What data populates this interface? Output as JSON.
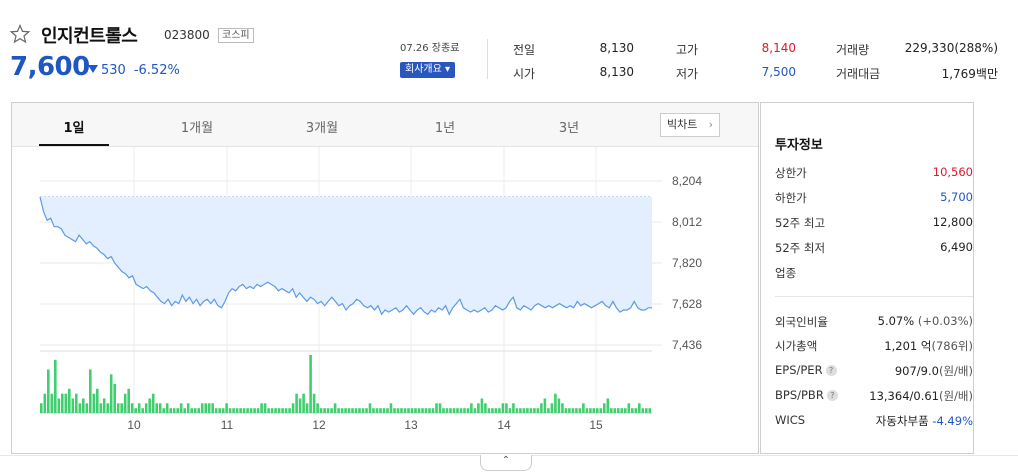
{
  "stock": {
    "name": "인지컨트롤스",
    "code": "023800",
    "market": "코스피",
    "price": "7,600",
    "change": "530",
    "change_pct": "-6.52%",
    "market_time": "07.26 장종료",
    "company_button": "회사개요 ▾"
  },
  "quote": {
    "prev_label": "전일",
    "prev": "8,130",
    "open_label": "시가",
    "open": "8,130",
    "high_label": "고가",
    "high": "8,140",
    "low_label": "저가",
    "low": "7,500",
    "volume_label": "거래량",
    "volume": "229,330(288%)",
    "amount_label": "거래대금",
    "amount": "1,769백만"
  },
  "tabs": [
    "1일",
    "1개월",
    "3개월",
    "1년",
    "3년"
  ],
  "big_chart_label": "빅차트",
  "fold_label": "⌃",
  "invest": {
    "title": "투자정보",
    "upper_label": "상한가",
    "upper": "10,560",
    "lower_label": "하한가",
    "lower": "5,700",
    "high52_label": "52주 최고",
    "high52": "12,800",
    "low52_label": "52주 최저",
    "low52": "6,490",
    "industry_label": "업종",
    "foreign_label": "외국인비율",
    "foreign": "5.07%",
    "foreign_chg": "(+0.03%)",
    "mcap_label": "시가총액",
    "mcap": "1,201 억",
    "mcap_rank": "(786위)",
    "eps_label": "EPS/PER",
    "eps": "907/9.0",
    "eps_unit": "(원/배)",
    "bps_label": "BPS/PBR",
    "bps": "13,364/0.61",
    "bps_unit": "(원/배)",
    "wics_label": "WICS",
    "wics": "자동차부품",
    "wics_chg": "-4.49%"
  },
  "colors": {
    "up": "#e0182d",
    "down": "#1e57c4",
    "area": "#e3efff",
    "line": "#5b9ae8",
    "volume": "#3fcf6e"
  },
  "chart_data": {
    "type": "line",
    "yticks": [
      "8,204",
      "8,012",
      "7,820",
      "7,628",
      "7,436"
    ],
    "ylim": [
      7436,
      8204
    ],
    "prev_close": 8130,
    "xticks": [
      "10",
      "11",
      "12",
      "13",
      "14",
      "15"
    ],
    "price": [
      8130,
      8060,
      8020,
      8030,
      7990,
      7990,
      7980,
      7950,
      7940,
      7930,
      7920,
      7950,
      7930,
      7910,
      7920,
      7900,
      7890,
      7870,
      7860,
      7840,
      7850,
      7820,
      7800,
      7780,
      7770,
      7750,
      7760,
      7720,
      7710,
      7700,
      7710,
      7690,
      7680,
      7660,
      7640,
      7630,
      7650,
      7620,
      7640,
      7630,
      7670,
      7640,
      7660,
      7630,
      7650,
      7620,
      7640,
      7650,
      7630,
      7650,
      7620,
      7610,
      7640,
      7680,
      7700,
      7690,
      7710,
      7720,
      7700,
      7710,
      7700,
      7720,
      7710,
      7720,
      7730,
      7720,
      7710,
      7690,
      7700,
      7690,
      7680,
      7700,
      7660,
      7680,
      7660,
      7640,
      7660,
      7650,
      7630,
      7640,
      7620,
      7640,
      7660,
      7640,
      7620,
      7630,
      7600,
      7620,
      7630,
      7650,
      7640,
      7620,
      7610,
      7620,
      7600,
      7620,
      7580,
      7600,
      7590,
      7600,
      7610,
      7590,
      7600,
      7620,
      7600,
      7580,
      7600,
      7610,
      7590,
      7580,
      7600,
      7590,
      7610,
      7600,
      7620,
      7580,
      7610,
      7630,
      7650,
      7610,
      7600,
      7590,
      7600,
      7590,
      7600,
      7610,
      7590,
      7600,
      7620,
      7610,
      7600,
      7610,
      7640,
      7660,
      7610,
      7600,
      7620,
      7610,
      7600,
      7620,
      7630,
      7620,
      7610,
      7620,
      7610,
      7620,
      7630,
      7620,
      7610,
      7620,
      7610,
      7640,
      7620,
      7630,
      7620,
      7610,
      7620,
      7630,
      7640,
      7620,
      7610,
      7640,
      7610,
      7590,
      7600,
      7600,
      7610,
      7640,
      7610,
      7600,
      7600,
      7610,
      7610
    ],
    "volume": [
      2,
      4,
      9,
      4,
      11,
      3,
      4,
      4,
      5,
      3,
      4,
      2,
      3,
      2,
      9,
      4,
      5,
      2,
      3,
      2,
      8,
      6,
      2,
      2,
      4,
      5,
      2,
      1,
      2,
      1,
      2,
      3,
      4,
      2,
      2,
      1,
      2,
      1,
      1,
      1,
      2,
      1,
      2,
      1,
      1,
      1,
      2,
      2,
      2,
      2,
      1,
      1,
      1,
      2,
      1,
      1,
      1,
      1,
      1,
      1,
      1,
      1,
      1,
      2,
      2,
      1,
      1,
      1,
      1,
      1,
      1,
      1,
      2,
      4,
      3,
      4,
      2,
      12,
      4,
      2,
      1,
      1,
      1,
      1,
      2,
      1,
      1,
      1,
      1,
      1,
      1,
      1,
      1,
      1,
      2,
      1,
      1,
      1,
      1,
      1,
      2,
      1,
      1,
      1,
      1,
      1,
      1,
      1,
      1,
      1,
      1,
      1,
      1,
      2,
      2,
      1,
      1,
      1,
      1,
      1,
      1,
      1,
      1,
      2,
      1,
      2,
      3,
      2,
      1,
      1,
      1,
      1,
      2,
      2,
      1,
      2,
      1,
      1,
      1,
      1,
      1,
      1,
      1,
      2,
      3,
      1,
      2,
      4,
      3,
      2,
      1,
      1,
      1,
      1,
      1,
      2,
      1,
      1,
      1,
      1,
      1,
      2,
      3,
      1,
      1,
      1,
      1,
      1,
      2,
      1,
      1,
      2,
      1,
      1,
      1
    ]
  }
}
